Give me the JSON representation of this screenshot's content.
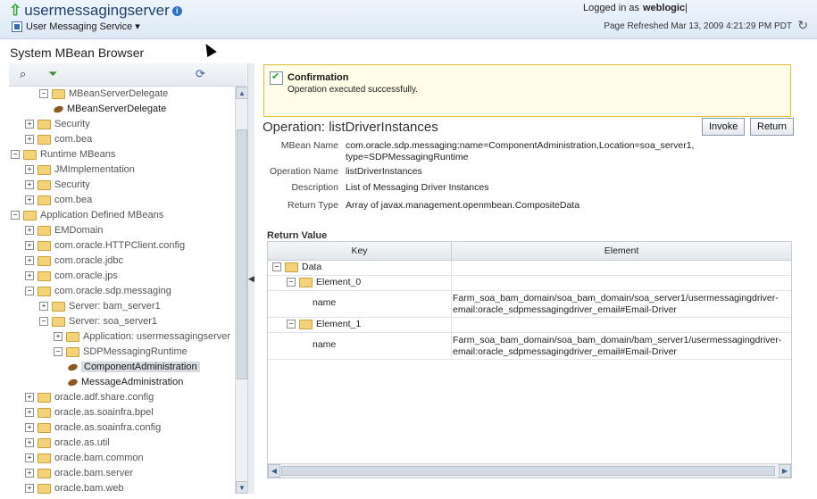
{
  "header": {
    "app_title": "usermessagingserver",
    "menu_label": "User Messaging Service",
    "logged_in_prefix": "Logged in as",
    "user": "weblogic",
    "page_refreshed": "Page Refreshed Mar 13, 2009 4:21:29 PM PDT"
  },
  "left": {
    "title": "System MBean Browser",
    "tree": [
      {
        "label": "MBeanServerDelegate",
        "type": "folder",
        "expand": "−",
        "level": 2
      },
      {
        "label": "MBeanServerDelegate",
        "type": "bean",
        "level": 3,
        "dark": true
      },
      {
        "label": "Security",
        "type": "folder",
        "expand": "+",
        "level": 1
      },
      {
        "label": "com.bea",
        "type": "folder",
        "expand": "+",
        "level": 1
      },
      {
        "label": "Runtime MBeans",
        "type": "folder",
        "expand": "−",
        "level": 0
      },
      {
        "label": "JMImplementation",
        "type": "folder",
        "expand": "+",
        "level": 1
      },
      {
        "label": "Security",
        "type": "folder",
        "expand": "+",
        "level": 1
      },
      {
        "label": "com.bea",
        "type": "folder",
        "expand": "+",
        "level": 1
      },
      {
        "label": "Application Defined MBeans",
        "type": "folder",
        "expand": "−",
        "level": 0
      },
      {
        "label": "EMDomain",
        "type": "folder",
        "expand": "+",
        "level": 1
      },
      {
        "label": "com.oracle.HTTPClient.config",
        "type": "folder",
        "expand": "+",
        "level": 1
      },
      {
        "label": "com.oracle.jdbc",
        "type": "folder",
        "expand": "+",
        "level": 1
      },
      {
        "label": "com.oracle.jps",
        "type": "folder",
        "expand": "+",
        "level": 1
      },
      {
        "label": "com.oracle.sdp.messaging",
        "type": "folder",
        "expand": "−",
        "level": 1
      },
      {
        "label": "Server: bam_server1",
        "type": "folder",
        "expand": "+",
        "level": 2
      },
      {
        "label": "Server: soa_server1",
        "type": "folder",
        "expand": "−",
        "level": 2
      },
      {
        "label": "Application: usermessagingserver",
        "type": "folder",
        "expand": "+",
        "level": 3
      },
      {
        "label": "SDPMessagingRuntime",
        "type": "folder",
        "expand": "−",
        "level": 3
      },
      {
        "label": "ComponentAdministration",
        "type": "bean",
        "level": 4,
        "dark": true,
        "selected": true
      },
      {
        "label": "MessageAdministration",
        "type": "bean",
        "level": 4,
        "dark": true
      },
      {
        "label": "oracle.adf.share.config",
        "type": "folder",
        "expand": "+",
        "level": 1
      },
      {
        "label": "oracle.as.soainfra.bpel",
        "type": "folder",
        "expand": "+",
        "level": 1
      },
      {
        "label": "oracle.as.soainfra.config",
        "type": "folder",
        "expand": "+",
        "level": 1
      },
      {
        "label": "oracle.as.util",
        "type": "folder",
        "expand": "+",
        "level": 1
      },
      {
        "label": "oracle.bam.common",
        "type": "folder",
        "expand": "+",
        "level": 1
      },
      {
        "label": "oracle.bam.server",
        "type": "folder",
        "expand": "+",
        "level": 1
      },
      {
        "label": "oracle.bam.web",
        "type": "folder",
        "expand": "+",
        "level": 1
      }
    ]
  },
  "confirmation": {
    "title": "Confirmation",
    "message": "Operation executed successfully."
  },
  "operation": {
    "heading": "Operation: listDriverInstances",
    "invoke_label": "Invoke",
    "return_label": "Return",
    "fields": [
      {
        "label": "MBean Name",
        "value_lines": [
          "com.oracle.sdp.messaging:name=ComponentAdministration,Location=soa_server1,",
          "type=SDPMessagingRuntime"
        ]
      },
      {
        "label": "Operation Name",
        "value_lines": [
          "listDriverInstances"
        ]
      },
      {
        "label": "Description",
        "value_lines": [
          "List of Messaging Driver Instances"
        ]
      },
      {
        "label": "Return Type",
        "value_lines": [
          "Array of javax.management.openmbean.CompositeData"
        ]
      }
    ]
  },
  "return_value": {
    "title": "Return Value",
    "columns": [
      "Key",
      "Element"
    ],
    "rows": [
      {
        "key": "Data",
        "expand": "−",
        "folder": true,
        "indent": 0,
        "value": []
      },
      {
        "key": "Element_0",
        "expand": "−",
        "folder": true,
        "indent": 1,
        "value": []
      },
      {
        "key": "name",
        "indent": 2,
        "value": [
          "Farm_soa_bam_domain/soa_bam_domain/soa_server1/usermessagingdriver-",
          "email:oracle_sdpmessagingdriver_email#Email-Driver"
        ]
      },
      {
        "key": "Element_1",
        "expand": "−",
        "folder": true,
        "indent": 1,
        "value": []
      },
      {
        "key": "name",
        "indent": 2,
        "value": [
          "Farm_soa_bam_domain/soa_bam_domain/bam_server1/usermessagingdriver-",
          "email:oracle_sdpmessagingdriver_email#Email-Driver"
        ]
      }
    ]
  },
  "colors": {
    "header_bg": "#dde9f6",
    "confirm_border": "#e0c13a",
    "confirm_bg": "#fffde8",
    "selected_node_bg": "#d6dbe2"
  }
}
